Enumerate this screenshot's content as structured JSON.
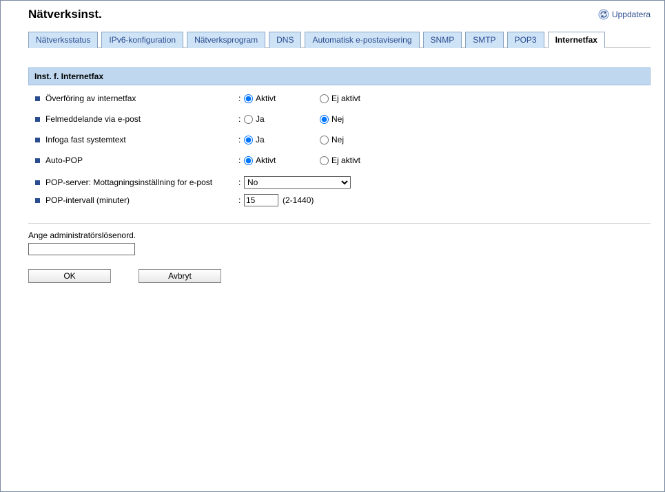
{
  "header": {
    "title": "Nätverksinst.",
    "refresh_label": "Uppdatera"
  },
  "tabs": [
    "Nätverksstatus",
    "IPv6-konfiguration",
    "Nätverksprogram",
    "DNS",
    "Automatisk e-postavisering",
    "SNMP",
    "SMTP",
    "POP3",
    "Internetfax"
  ],
  "section": {
    "heading": "Inst. f. Internetfax",
    "rows": {
      "transfer": {
        "label": "Överföring av internetfax",
        "opt1": "Aktivt",
        "opt2": "Ej aktivt"
      },
      "errmail": {
        "label": "Felmeddelande via e-post",
        "opt1": "Ja",
        "opt2": "Nej"
      },
      "systext": {
        "label": "Infoga fast systemtext",
        "opt1": "Ja",
        "opt2": "Nej"
      },
      "autopop": {
        "label": "Auto-POP",
        "opt1": "Aktivt",
        "opt2": "Ej aktivt"
      },
      "popserver": {
        "label": "POP-server: Mottagningsinställning for e-post",
        "value": "No"
      },
      "popinterval": {
        "label": "POP-intervall (minuter)",
        "value": "15",
        "hint": "(2-1440)"
      }
    }
  },
  "password": {
    "label": "Ange administratörslösenord."
  },
  "buttons": {
    "ok": "OK",
    "cancel": "Avbryt"
  }
}
